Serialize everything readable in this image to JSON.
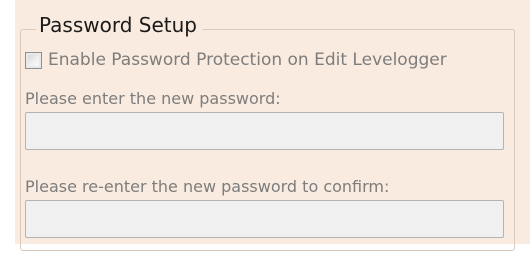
{
  "password_setup": {
    "title": "Password Setup",
    "enable_checkbox": {
      "label": "Enable Password Protection on Edit Levelogger",
      "checked": false
    },
    "new_password": {
      "label": "Please enter the new password:",
      "value": "",
      "enabled": false
    },
    "confirm_password": {
      "label": "Please re-enter the new password to confirm:",
      "value": "",
      "enabled": false
    }
  },
  "colors": {
    "panel_background": "#f9ebdf",
    "disabled_text": "#7d7d7d",
    "disabled_field": "#f0f0f0"
  }
}
